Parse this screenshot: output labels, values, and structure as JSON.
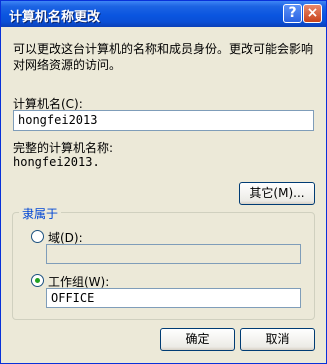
{
  "window": {
    "title": "计算机名称更改",
    "help_glyph": "?",
    "close_glyph": "×"
  },
  "intro": {
    "line1": "可以更改这台计算机的名称和成员身份。更改可能会影响",
    "line2": "对网络资源的访问。"
  },
  "computer_name": {
    "label": "计算机名(C):",
    "value": "hongfei2013"
  },
  "full_name": {
    "label": "完整的计算机名称:",
    "value": "hongfei2013."
  },
  "other_button": "其它(M)...",
  "member_of": {
    "title": "隶属于",
    "domain_label": "域(D):",
    "domain_value": "",
    "domain_selected": false,
    "workgroup_label": "工作组(W):",
    "workgroup_value": "OFFICE",
    "workgroup_selected": true
  },
  "ok_button": "确定",
  "cancel_button": "取消"
}
